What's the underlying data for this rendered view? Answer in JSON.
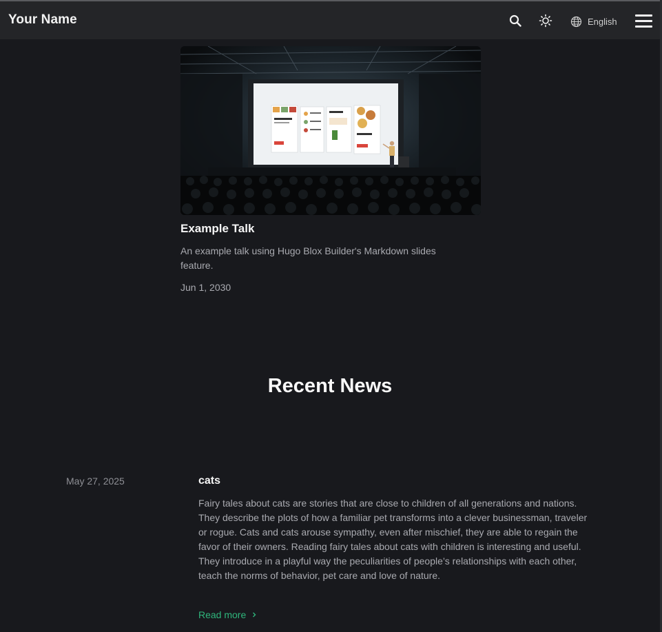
{
  "header": {
    "brand": "Your Name",
    "language": "English"
  },
  "talk": {
    "title": "Example Talk",
    "description": "An example talk using Hugo Blox Builder's Markdown slides feature.",
    "date": "Jun 1, 2030"
  },
  "news_section": {
    "heading": "Recent News",
    "items": [
      {
        "date": "May 27, 2025",
        "title": "cats",
        "summary": "Fairy tales about cats are stories that are close to children of all generations and nations. They describe the plots of how a familiar pet transforms into a clever businessman, traveler or rogue. Cats and cats arouse sympathy, even after mischief, they are able to regain the favor of their owners. Reading fairy tales about cats with children is interesting and useful. They introduce in a playful way the peculiarities of people’s relationships with each other, teach the norms of behavior, pet care and love of nature.",
        "read_more": "Read more"
      }
    ]
  },
  "colors": {
    "background": "#18191d",
    "header": "#242528",
    "accent": "#2fb67c"
  },
  "icons": [
    "search-icon",
    "sun-icon",
    "globe-icon",
    "hamburger-menu-icon",
    "chevron-right-icon"
  ]
}
